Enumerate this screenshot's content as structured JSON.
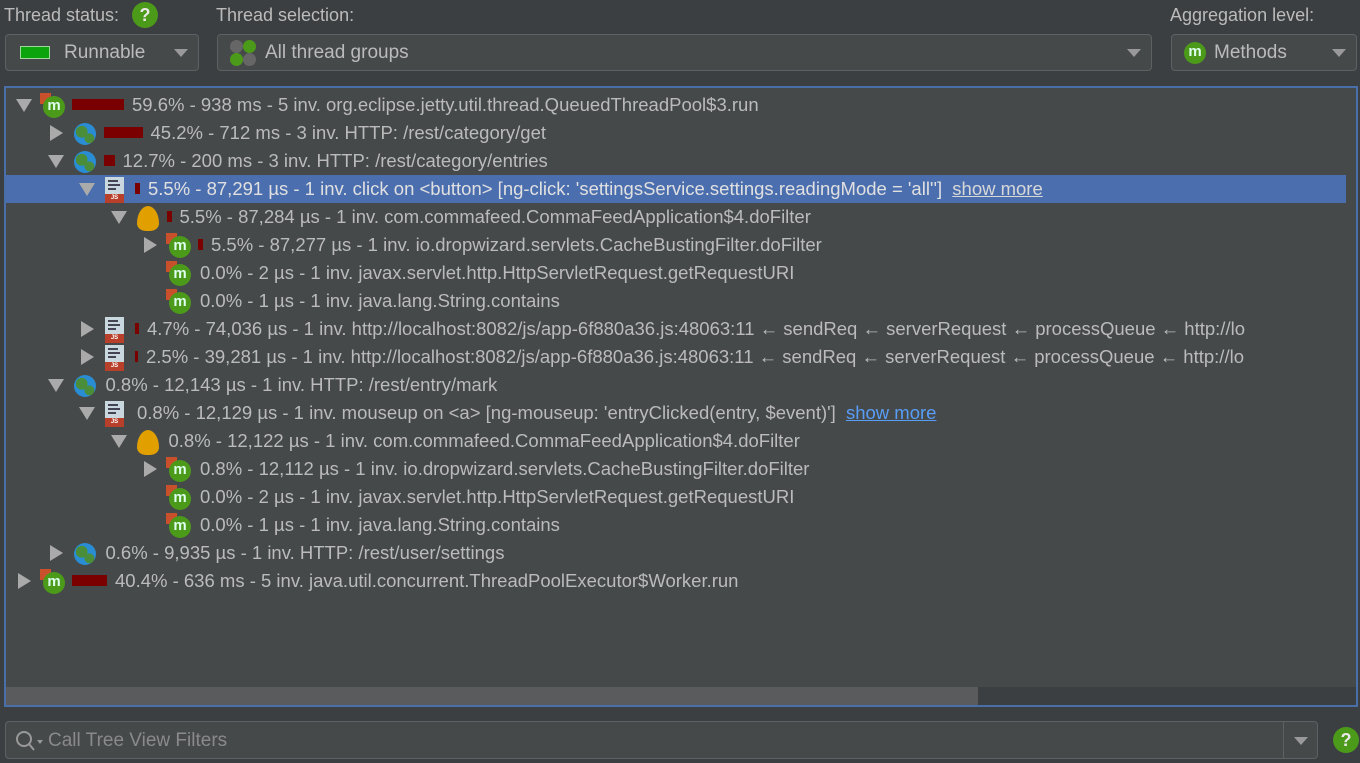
{
  "header": {
    "thread_status_label": "Thread status:",
    "thread_status_value": "Runnable",
    "thread_selection_label": "Thread selection:",
    "thread_selection_value": "All thread groups",
    "aggregation_label": "Aggregation level:",
    "aggregation_value": "Methods",
    "help": "?"
  },
  "colors": {
    "accent": "#4b6eaf",
    "bar": "#7a0000",
    "runnable": "#0ca40c"
  },
  "tree": [
    {
      "level": 0,
      "state": "open",
      "icon": "method-icon",
      "pct": 59.6,
      "text": "59.6% - 938 ms - 5 inv. org.eclipse.jetty.util.thread.QueuedThreadPool$3.run"
    },
    {
      "level": 1,
      "state": "closed",
      "icon": "globe-icon",
      "pct": 45.2,
      "text": "45.2% - 712 ms - 3 inv. HTTP: /rest/category/get"
    },
    {
      "level": 1,
      "state": "open",
      "icon": "globe-icon",
      "pct": 12.7,
      "text": "12.7% - 200 ms - 3 inv. HTTP: /rest/category/entries"
    },
    {
      "level": 2,
      "state": "open",
      "icon": "js-icon",
      "pct": 5.5,
      "selected": true,
      "text": "5.5% - 87,291 µs - 1 inv. click on <button> [ng-click: 'settingsService.settings.readingMode = 'all''] ",
      "link": "show more"
    },
    {
      "level": 3,
      "state": "open",
      "icon": "bean-icon",
      "pct": 5.5,
      "text": "5.5% - 87,284 µs - 1 inv. com.commafeed.CommaFeedApplication$4.doFilter"
    },
    {
      "level": 4,
      "state": "closed",
      "icon": "method-icon",
      "pct": 5.5,
      "text": "5.5% - 87,277 µs - 1 inv. io.dropwizard.servlets.CacheBustingFilter.doFilter"
    },
    {
      "level": 4,
      "state": "none",
      "icon": "method-icon",
      "pct": 0,
      "text": "0.0% - 2 µs - 1 inv. javax.servlet.http.HttpServletRequest.getRequestURI"
    },
    {
      "level": 4,
      "state": "none",
      "icon": "method-icon",
      "pct": 0,
      "text": "0.0% - 1 µs - 1 inv. java.lang.String.contains"
    },
    {
      "level": 2,
      "state": "closed",
      "icon": "js-icon",
      "pct": 4.7,
      "text": "4.7% - 74,036 µs - 1 inv. http://localhost:8082/js/app-6f880a36.js:48063:11 ← sendReq ← serverRequest ← processQueue ← http://lo"
    },
    {
      "level": 2,
      "state": "closed",
      "icon": "js-icon",
      "pct": 2.5,
      "text": "2.5% - 39,281 µs - 1 inv. http://localhost:8082/js/app-6f880a36.js:48063:11 ← sendReq ← serverRequest ← processQueue ← http://lo"
    },
    {
      "level": 1,
      "state": "open",
      "icon": "globe-icon",
      "pct": 0.8,
      "text": "0.8% - 12,143 µs - 1 inv. HTTP: /rest/entry/mark"
    },
    {
      "level": 2,
      "state": "open",
      "icon": "js-icon",
      "pct": 0.8,
      "text": "0.8% - 12,129 µs - 1 inv. mouseup on <a> [ng-mouseup: 'entryClicked(entry, $event)'] ",
      "link": "show more"
    },
    {
      "level": 3,
      "state": "open",
      "icon": "bean-icon",
      "pct": 0.8,
      "text": "0.8% - 12,122 µs - 1 inv. com.commafeed.CommaFeedApplication$4.doFilter"
    },
    {
      "level": 4,
      "state": "closed",
      "icon": "method-icon",
      "pct": 0.8,
      "text": "0.8% - 12,112 µs - 1 inv. io.dropwizard.servlets.CacheBustingFilter.doFilter"
    },
    {
      "level": 4,
      "state": "none",
      "icon": "method-icon",
      "pct": 0,
      "text": "0.0% - 2 µs - 1 inv. javax.servlet.http.HttpServletRequest.getRequestURI"
    },
    {
      "level": 4,
      "state": "none",
      "icon": "method-icon",
      "pct": 0,
      "text": "0.0% - 1 µs - 1 inv. java.lang.String.contains"
    },
    {
      "level": 1,
      "state": "closed",
      "icon": "globe-icon",
      "pct": 0.6,
      "text": "0.6% - 9,935 µs - 1 inv. HTTP: /rest/user/settings"
    },
    {
      "level": 0,
      "state": "closed",
      "icon": "method-icon",
      "pct": 40.4,
      "text": "40.4% - 636 ms - 5 inv. java.util.concurrent.ThreadPoolExecutor$Worker.run"
    }
  ],
  "filter": {
    "placeholder": "Call Tree View Filters"
  },
  "scroll": {
    "horizontal_visible_fraction": 0.72
  }
}
